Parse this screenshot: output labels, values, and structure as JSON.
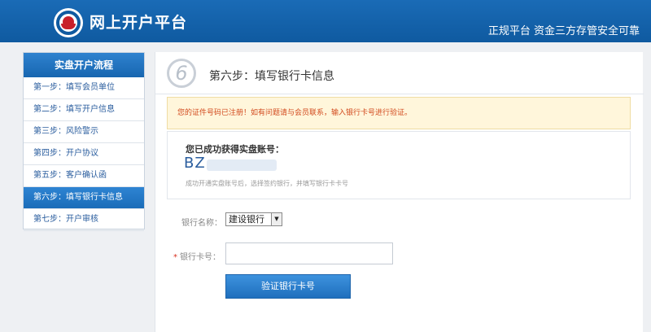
{
  "header": {
    "brand": "网上开户平台",
    "slogan": "正规平台 资金三方存管安全可靠"
  },
  "sidebar": {
    "title": "实盘开户流程",
    "items": [
      {
        "label": "第一步：填写会员单位"
      },
      {
        "label": "第二步：填写开户信息"
      },
      {
        "label": "第三步：风险警示"
      },
      {
        "label": "第四步：开户协议"
      },
      {
        "label": "第五步：客户确认函"
      },
      {
        "label": "第六步：填写银行卡信息",
        "active": true
      },
      {
        "label": "第七步：开户审核"
      }
    ]
  },
  "main": {
    "step_number": "6",
    "step_title": "第六步：填写银行卡信息",
    "notice": "您的证件号码已注册！如有问题请与会员联系，输入银行卡号进行验证。",
    "account": {
      "title": "您已成功获得实盘账号：",
      "number": "BZ",
      "hint": "成功开通实盘账号后，选择签约银行，并填写银行卡卡号"
    },
    "form": {
      "bank_label": "银行名称：",
      "bank_value": "建设银行",
      "card_label": "银行卡号：",
      "card_value": "",
      "verify_button": "验证银行卡号"
    }
  },
  "colors": {
    "header_blue": "#0f5aa0",
    "active_blue": "#1a6cb8",
    "notice_text": "#d24a1e",
    "notice_bg": "#fff6db"
  }
}
